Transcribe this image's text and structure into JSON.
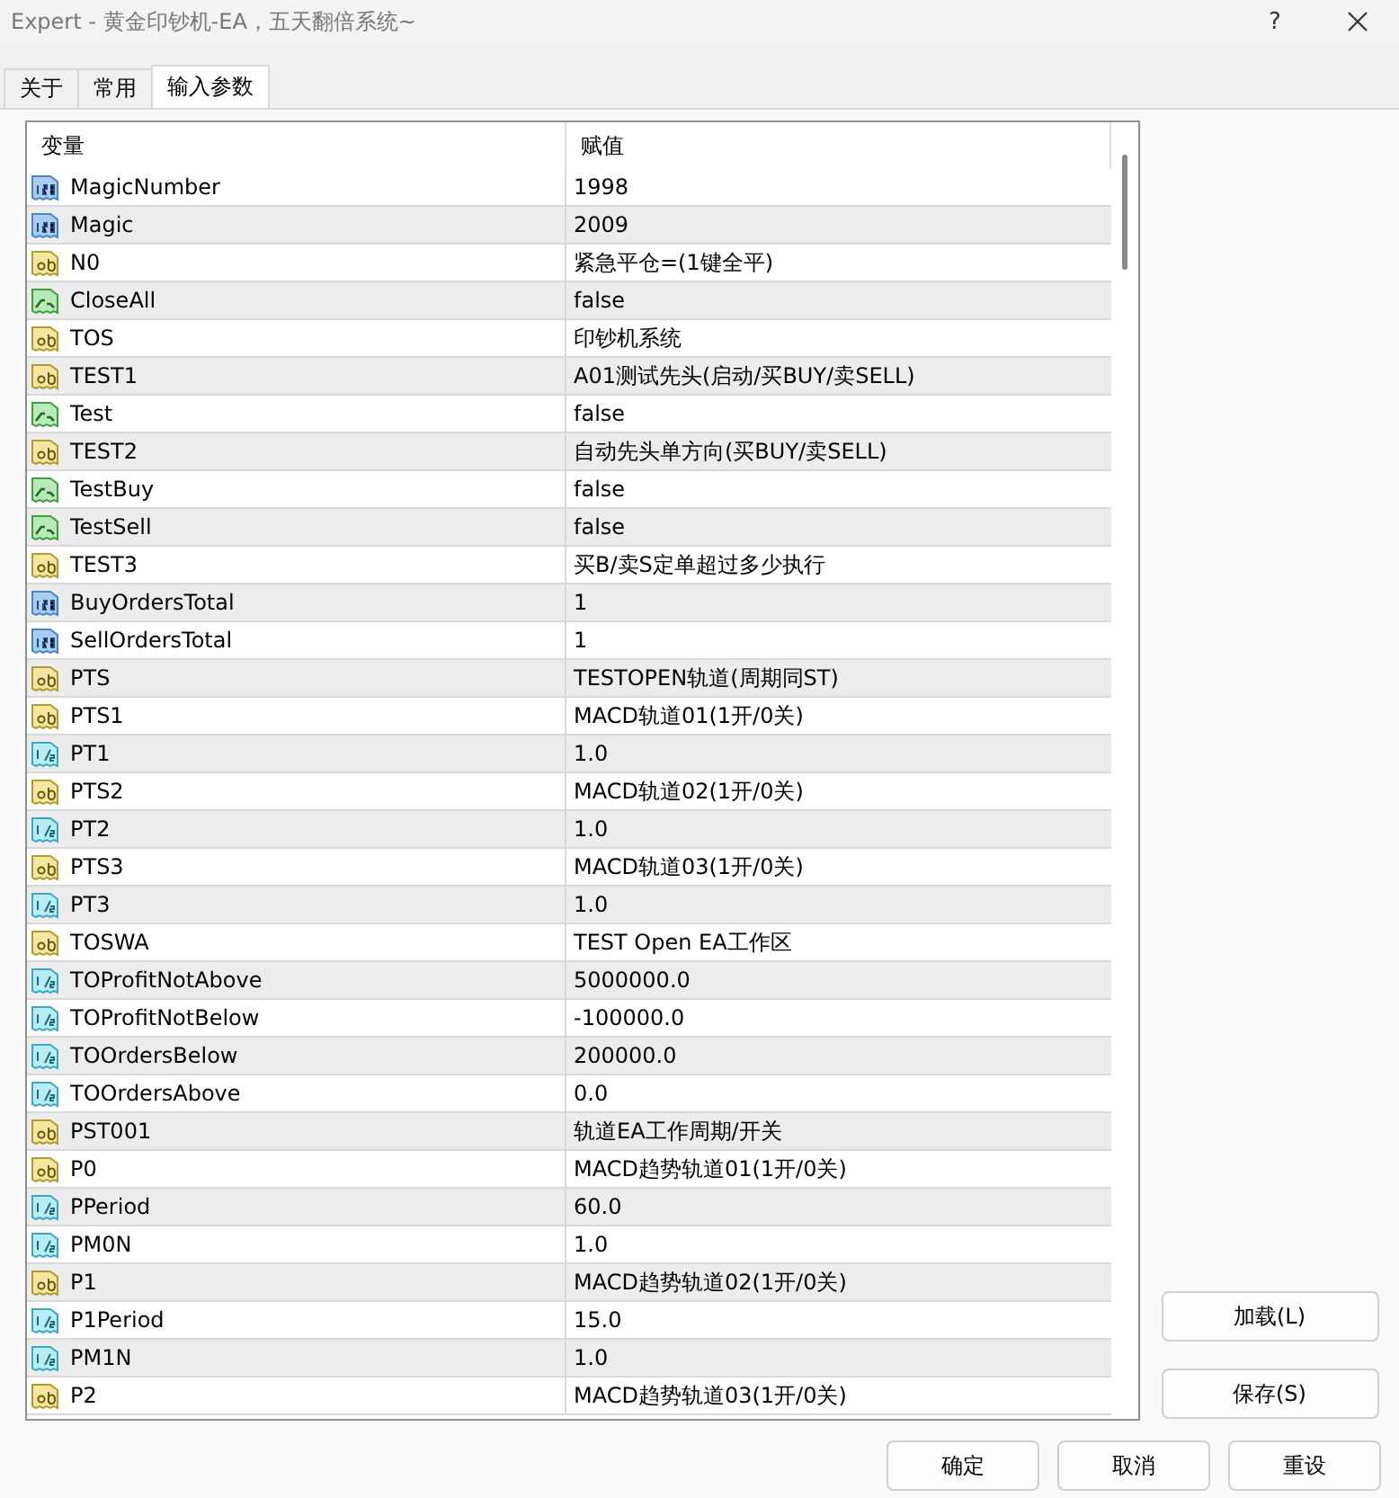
{
  "window": {
    "title": "Expert - 黄金印钞机-EA，五天翻倍系统~",
    "help": "?"
  },
  "tabs": [
    {
      "label": "关于",
      "selected": false
    },
    {
      "label": "常用",
      "selected": false
    },
    {
      "label": "输入参数",
      "selected": true
    }
  ],
  "table": {
    "columns": [
      "变量",
      "赋值"
    ],
    "rows": [
      {
        "kind": "int",
        "name": "MagicNumber",
        "value": "1998"
      },
      {
        "kind": "int",
        "name": "Magic",
        "value": "2009"
      },
      {
        "kind": "string",
        "name": "N0",
        "value": "紧急平仓=(1键全平)"
      },
      {
        "kind": "bool",
        "name": "CloseAll",
        "value": "false"
      },
      {
        "kind": "string",
        "name": "TOS",
        "value": "印钞机系统"
      },
      {
        "kind": "string",
        "name": "TEST1",
        "value": "A01测试先头(启动/买BUY/卖SELL)"
      },
      {
        "kind": "bool",
        "name": "Test",
        "value": "false"
      },
      {
        "kind": "string",
        "name": "TEST2",
        "value": "自动先头单方向(买BUY/卖SELL)"
      },
      {
        "kind": "bool",
        "name": "TestBuy",
        "value": "false"
      },
      {
        "kind": "bool",
        "name": "TestSell",
        "value": "false"
      },
      {
        "kind": "string",
        "name": "TEST3",
        "value": "买B/卖S定单超过多少执行"
      },
      {
        "kind": "int",
        "name": "BuyOrdersTotal",
        "value": "1"
      },
      {
        "kind": "int",
        "name": "SellOrdersTotal",
        "value": "1"
      },
      {
        "kind": "string",
        "name": "PTS",
        "value": "TESTOPEN轨道(周期同ST)"
      },
      {
        "kind": "string",
        "name": "PTS1",
        "value": "MACD轨道01(1开/0关)"
      },
      {
        "kind": "double",
        "name": "PT1",
        "value": "1.0"
      },
      {
        "kind": "string",
        "name": "PTS2",
        "value": "MACD轨道02(1开/0关)"
      },
      {
        "kind": "double",
        "name": "PT2",
        "value": "1.0"
      },
      {
        "kind": "string",
        "name": "PTS3",
        "value": "MACD轨道03(1开/0关)"
      },
      {
        "kind": "double",
        "name": "PT3",
        "value": "1.0"
      },
      {
        "kind": "string",
        "name": "TOSWA",
        "value": "TEST Open EA工作区"
      },
      {
        "kind": "double",
        "name": "TOProfitNotAbove",
        "value": "5000000.0"
      },
      {
        "kind": "double",
        "name": "TOProfitNotBelow",
        "value": "-100000.0"
      },
      {
        "kind": "double",
        "name": "TOOrdersBelow",
        "value": "200000.0"
      },
      {
        "kind": "double",
        "name": "TOOrdersAbove",
        "value": "0.0"
      },
      {
        "kind": "string",
        "name": "PST001",
        "value": "轨道EA工作周期/开关"
      },
      {
        "kind": "string",
        "name": "P0",
        "value": "MACD趋势轨道01(1开/0关)"
      },
      {
        "kind": "double",
        "name": "PPeriod",
        "value": "60.0"
      },
      {
        "kind": "double",
        "name": "PM0N",
        "value": "1.0"
      },
      {
        "kind": "string",
        "name": "P1",
        "value": "MACD趋势轨道02(1开/0关)"
      },
      {
        "kind": "double",
        "name": "P1Period",
        "value": "15.0"
      },
      {
        "kind": "double",
        "name": "PM1N",
        "value": "1.0"
      },
      {
        "kind": "string",
        "name": "P2",
        "value": "MACD趋势轨道03(1开/0关)"
      }
    ]
  },
  "side_buttons": [
    "加载(L)",
    "保存(S)"
  ],
  "bottom_buttons": [
    "确定",
    "取消",
    "重设"
  ]
}
